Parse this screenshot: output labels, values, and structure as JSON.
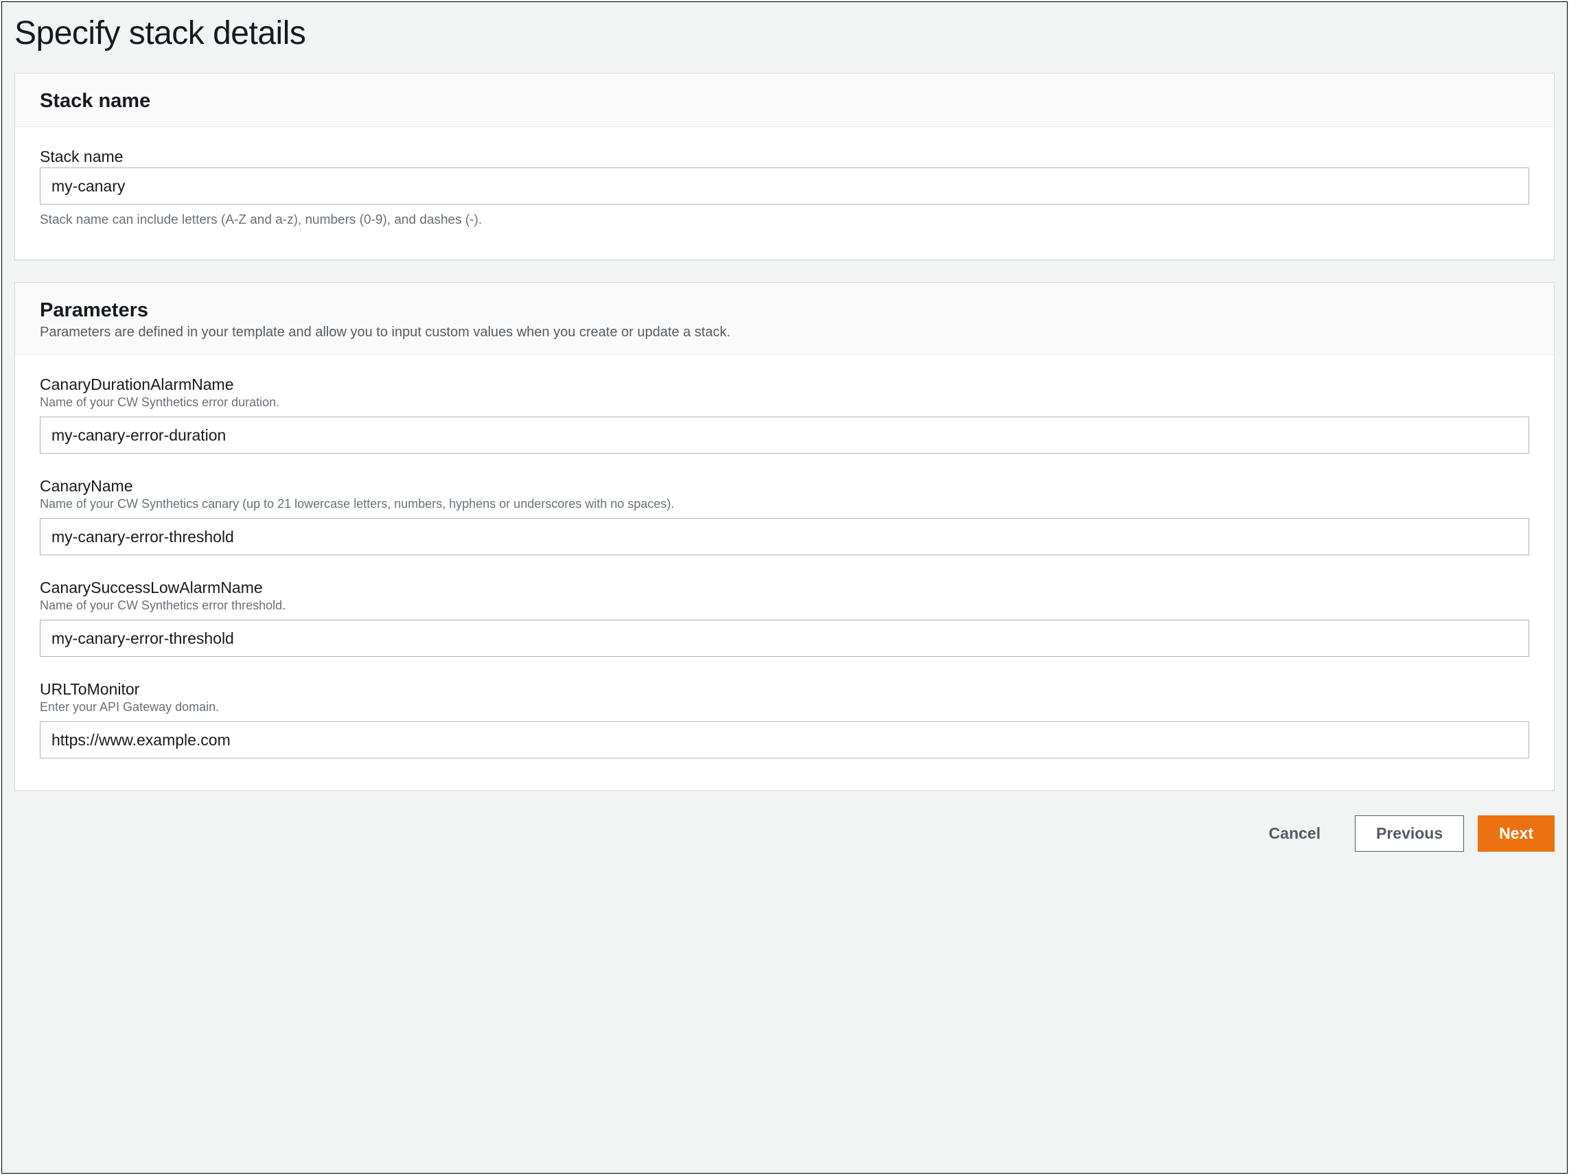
{
  "page": {
    "title": "Specify stack details"
  },
  "stackNamePanel": {
    "title": "Stack name",
    "field": {
      "label": "Stack name",
      "value": "my-canary",
      "helpText": "Stack name can include letters (A-Z and a-z), numbers (0-9), and dashes (-)."
    }
  },
  "parametersPanel": {
    "title": "Parameters",
    "subtitle": "Parameters are defined in your template and allow you to input custom values when you create or update a stack.",
    "params": {
      "canaryDurationAlarmName": {
        "label": "CanaryDurationAlarmName",
        "description": "Name of your CW Synthetics error duration.",
        "value": "my-canary-error-duration"
      },
      "canaryName": {
        "label": "CanaryName",
        "description": "Name of your CW Synthetics canary (up to 21 lowercase letters, numbers, hyphens or underscores with no spaces).",
        "value": "my-canary-error-threshold"
      },
      "canarySuccessLowAlarmName": {
        "label": "CanarySuccessLowAlarmName",
        "description": "Name of your CW Synthetics error threshold.",
        "value": "my-canary-error-threshold"
      },
      "urlToMonitor": {
        "label": "URLToMonitor",
        "description": "Enter your API Gateway domain.",
        "value": "https://www.example.com"
      }
    }
  },
  "buttons": {
    "cancel": "Cancel",
    "previous": "Previous",
    "next": "Next"
  }
}
